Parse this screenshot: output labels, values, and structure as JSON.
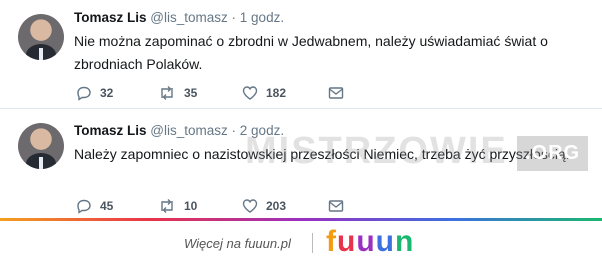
{
  "tweets": [
    {
      "name": "Tomasz Lis",
      "handle": "@lis_tomasz",
      "time": "· 1 godz.",
      "text": "Nie można zapominać o zbrodni w Jedwabnem, należy uświadamiać świat o zbrodniach Polaków.",
      "replies": "32",
      "retweets": "35",
      "likes": "182"
    },
    {
      "name": "Tomasz Lis",
      "handle": "@lis_tomasz",
      "time": "· 2 godz.",
      "text": "Należy zapomniec o nazistowskiej przeszłości Niemiec, trzeba żyć przyszłością.",
      "replies": "45",
      "retweets": "10",
      "likes": "203"
    }
  ],
  "watermark": {
    "main": "MISTRZOWIE",
    "suffix": ".ORG"
  },
  "footer": {
    "more_text": "Więcej na fuuun.pl",
    "brand_letters": [
      "f",
      "u",
      "u",
      "u",
      "n"
    ],
    "brand_colors": [
      "#f39c12",
      "#e8334a",
      "#9b2fbf",
      "#3d6fe0",
      "#1ab86e"
    ]
  },
  "icons": [
    "reply-icon",
    "retweet-icon",
    "like-icon",
    "direct-message-icon"
  ]
}
